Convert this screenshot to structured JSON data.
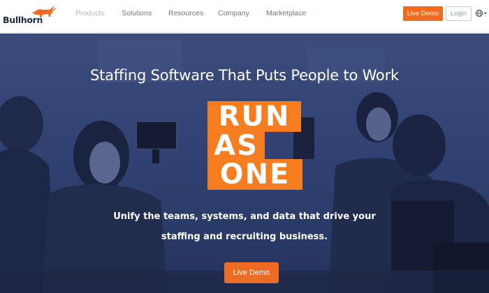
{
  "brand": {
    "name": "Bullhorn",
    "accent": "#ef6b21"
  },
  "nav": {
    "items": [
      {
        "label": "Products"
      },
      {
        "label": "Solutions"
      },
      {
        "label": "Resources"
      },
      {
        "label": "Company"
      },
      {
        "label": "Marketplace"
      }
    ],
    "live_demo_label": "Live Demo",
    "login_label": "Login",
    "language_icon": "globe-icon"
  },
  "hero": {
    "title": "Staffing Software That Puts People to Work",
    "tagline": [
      "RUN",
      "AS",
      "ONE"
    ],
    "subtitle_line1": "Unify the teams, systems, and data that drive your",
    "subtitle_line2": "staffing and recruiting business.",
    "cta_label": "Live Demo",
    "overlay_color": "#2e3f6e",
    "tagline_color": "#f57c1f"
  }
}
